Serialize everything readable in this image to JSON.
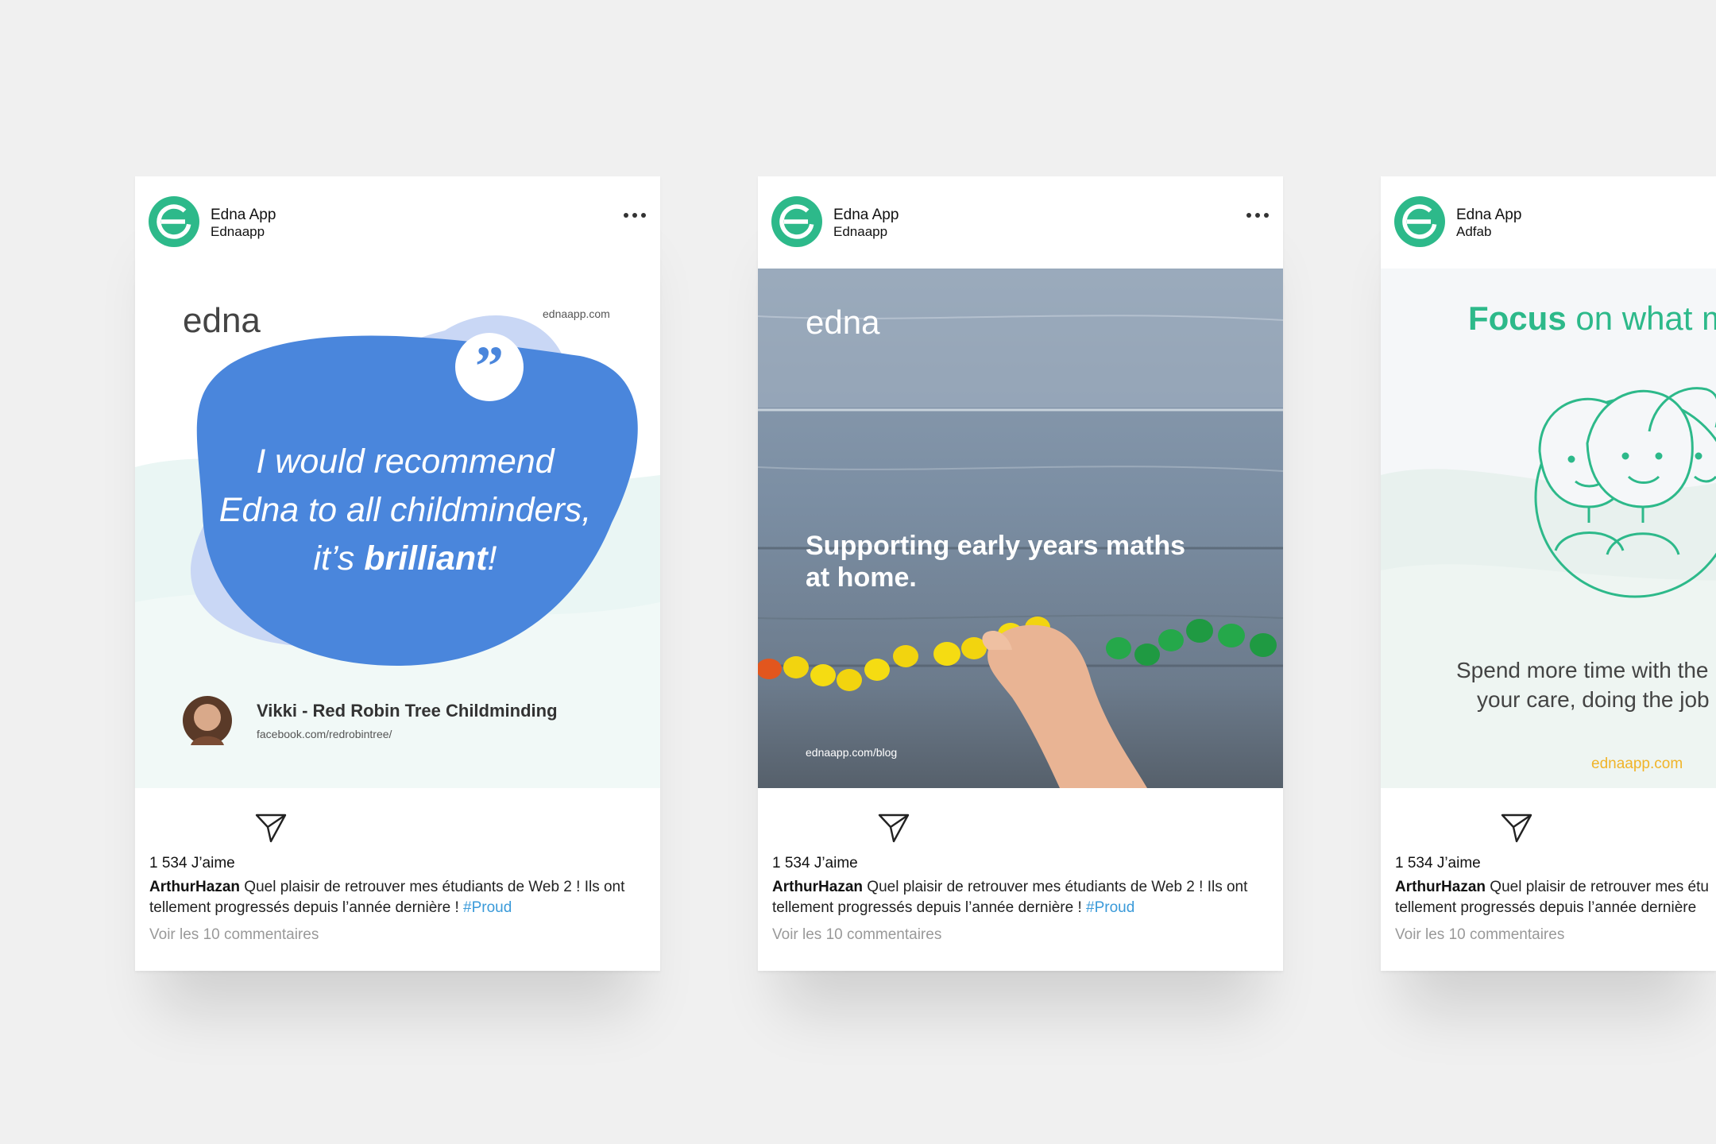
{
  "posts": [
    {
      "account_name": "Edna App",
      "account_handle": "Ednaapp",
      "media": {
        "brand": "edna",
        "site": "ednaapp.com",
        "quote_lines": [
          "I would recommend",
          "Edna to all childminders,"
        ],
        "quote_end_prefix": "it’s ",
        "quote_end_bold": "brilliant",
        "quote_end_suffix": "!",
        "author": "Vikki - Red Robin Tree Childminding",
        "author_link": "facebook.com/redrobintree/"
      },
      "likes": "1 534 J’aime",
      "caption_user": "ArthurHazan",
      "caption_text": " Quel plaisir de retrouver mes étudiants de Web 2 ! Ils ont tellement progressés depuis l’année dernière ! ",
      "caption_tag": "#Proud",
      "comments_link": "Voir les 10 commentaires"
    },
    {
      "account_name": "Edna App",
      "account_handle": "Ednaapp",
      "media": {
        "brand": "edna",
        "headline_line1": "Supporting early years maths",
        "headline_line2": "at home.",
        "link": "ednaapp.com/blog"
      },
      "likes": "1 534 J’aime",
      "caption_user": "ArthurHazan",
      "caption_text": " Quel plaisir de retrouver mes étudiants de Web 2 ! Ils ont tellement progressés depuis l’année dernière ! ",
      "caption_tag": "#Proud",
      "comments_link": "Voir les 10 commentaires"
    },
    {
      "account_name": "Edna App",
      "account_handle": "Adfab",
      "media": {
        "title_bold": "Focus",
        "title_rest": " on what m",
        "body_line1": "Spend more time with the",
        "body_line2": "your care, doing the job",
        "site": "ednaapp.com"
      },
      "likes": "1 534 J’aime",
      "caption_user": "ArthurHazan",
      "caption_line1": " Quel plaisir de retrouver mes étu",
      "caption_line2": "tellement progressés depuis l’année dernière",
      "comments_link": "Voir les 10 commentaires"
    }
  ],
  "colors": {
    "brand_green": "#2db98a",
    "quote_blue": "#4a86dc",
    "hashtag_blue": "#3a9ad9",
    "url_yellow": "#f0b429"
  },
  "icons": [
    "edna-logo-icon",
    "more-options-icon",
    "send-icon",
    "quote-icon",
    "group-faces-icon"
  ]
}
